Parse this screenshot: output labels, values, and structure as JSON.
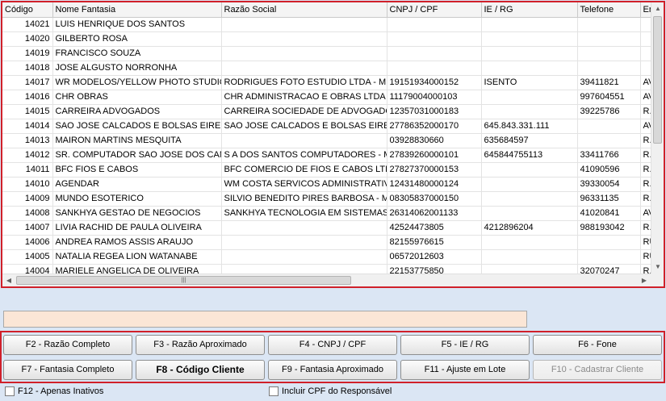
{
  "grid": {
    "columns": [
      "Código",
      "Nome Fantasia",
      "Razão Social",
      "CNPJ / CPF",
      "IE / RG",
      "Telefone",
      "En"
    ],
    "rows": [
      [
        "14021",
        "LUIS HENRIQUE DOS SANTOS",
        "",
        "",
        "",
        "",
        ""
      ],
      [
        "14020",
        "GILBERTO ROSA",
        "",
        "",
        "",
        "",
        ""
      ],
      [
        "14019",
        "FRANCISCO SOUZA",
        "",
        "",
        "",
        "",
        ""
      ],
      [
        "14018",
        "JOSE ALGUSTO NORRONHA",
        "",
        "",
        "",
        "",
        ""
      ],
      [
        "14017",
        "WR MODELOS/YELLOW PHOTO STUDIO",
        "RODRIGUES FOTO ESTUDIO LTDA - ME",
        "19151934000152",
        "ISENTO",
        "39411821",
        "AV"
      ],
      [
        "14016",
        "CHR OBRAS",
        "CHR ADMINISTRACAO E OBRAS LTDA - M",
        "11179004000103",
        "",
        "997604551",
        "AV"
      ],
      [
        "14015",
        "CARREIRA ADVOGADOS",
        "CARREIRA SOCIEDADE DE ADVOGADOS",
        "12357031000183",
        "",
        "39225786",
        "R."
      ],
      [
        "14014",
        "SAO JOSE CALCADOS E BOLSAS EIRELI - E",
        "SAO JOSE CALCADOS E BOLSAS EIRELI -",
        "27786352000170",
        "645.843.331.111",
        "",
        "AV"
      ],
      [
        "14013",
        "MAIRON MARTINS MESQUITA",
        "",
        "03928830660",
        "635684597",
        "",
        "R."
      ],
      [
        "14012",
        "SR. COMPUTADOR SAO JOSE DOS CAMPC",
        "S A DOS SANTOS COMPUTADORES - ME",
        "27839260000101",
        "645844755113",
        "33411766",
        "R."
      ],
      [
        "14011",
        "BFC FIOS E CABOS",
        "BFC COMERCIO DE FIOS E CABOS LTDA -",
        "27827370000153",
        "",
        "41090596",
        "R."
      ],
      [
        "14010",
        "AGENDAR",
        "WM COSTA SERVICOS ADMINISTRATIVOS",
        "12431480000124",
        "",
        "39330054",
        "R."
      ],
      [
        "14009",
        "MUNDO ESOTERICO",
        "SILVIO BENEDITO PIRES BARBOSA - ME",
        "08305837000150",
        "",
        "96331135",
        "R."
      ],
      [
        "14008",
        "SANKHYA GESTAO DE NEGOCIOS",
        "SANKHYA TECNOLOGIA EM SISTEMAS LTD",
        "26314062001133",
        "",
        "41020841",
        "AV"
      ],
      [
        "14007",
        "LIVIA RACHID DE PAULA OLIVEIRA",
        "",
        "42524473805",
        "4212896204",
        "988193042",
        "R."
      ],
      [
        "14006",
        "ANDREA RAMOS ASSIS ARAUJO",
        "",
        "82155976615",
        "",
        "",
        "RU"
      ],
      [
        "14005",
        "NATALIA REGEA LION WATANABE",
        "",
        "06572012603",
        "",
        "",
        "RU"
      ],
      [
        "14004",
        "MARIELE ANGELICA DE OLIVEIRA",
        "",
        "22153775850",
        "",
        "32070247",
        "R."
      ]
    ]
  },
  "buttons": {
    "f2": "F2 - Razão Completo",
    "f3": "F3 - Razão Aproximado",
    "f4": "F4 - CNPJ / CPF",
    "f5": "F5 - IE / RG",
    "f6": "F6 - Fone",
    "f7": "F7 - Fantasia Completo",
    "f8": "F8 - Código Cliente",
    "f9": "F9 - Fantasia Aproximado",
    "f11": "F11 - Ajuste em Lote",
    "f10": "F10 - Cadastrar Cliente"
  },
  "checkboxes": {
    "inativos": "F12 - Apenas Inativos",
    "cpf_responsavel": "Incluir CPF do Responsável"
  },
  "scroll": {
    "thumb_grip": "|||"
  },
  "colors": {
    "highlight_border": "#d0202a",
    "background": "#dbe6f4",
    "info_box": "#fbe6d6"
  }
}
